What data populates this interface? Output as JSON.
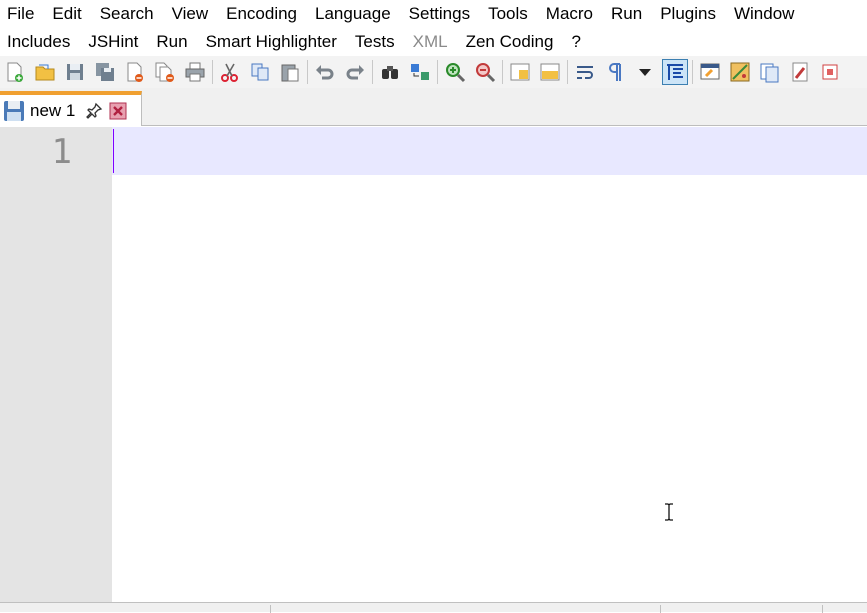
{
  "menubar": {
    "items": [
      "File",
      "Edit",
      "Search",
      "View",
      "Encoding",
      "Language",
      "Settings",
      "Tools",
      "Macro",
      "Run",
      "Plugins",
      "Window"
    ]
  },
  "plugins_menubar": {
    "items": [
      "Includes",
      "JSHint",
      "Run",
      "Smart Highlighter",
      "Tests",
      "XML",
      "Zen Coding",
      "?"
    ],
    "disabled_item": "XML"
  },
  "toolbar": {
    "icons": [
      "new-file-icon",
      "open-file-icon",
      "save-icon",
      "save-all-icon",
      "close-icon",
      "close-all-icon",
      "print-icon",
      "cut-icon",
      "copy-icon",
      "paste-icon",
      "undo-icon",
      "redo-icon",
      "find-icon",
      "replace-icon",
      "zoom-in-icon",
      "zoom-out-icon",
      "sync-vertical-icon",
      "sync-horizontal-icon",
      "word-wrap-icon",
      "show-all-characters-icon",
      "dropdown-arrow-icon",
      "indent-guide-icon",
      "user-defined-language-icon",
      "doc-map-icon",
      "function-list-icon",
      "macro-record-icon"
    ],
    "active_icon": "indent-guide-icon"
  },
  "tabs": [
    {
      "label": "new 1",
      "active": true
    }
  ],
  "editor": {
    "line_numbers": [
      "1"
    ],
    "current_line_color": "#e8e8ff",
    "caret_color": "#8000ff"
  },
  "colors": {
    "active_tab_accent": "#f0a030",
    "gutter": "#e4e4e4"
  }
}
